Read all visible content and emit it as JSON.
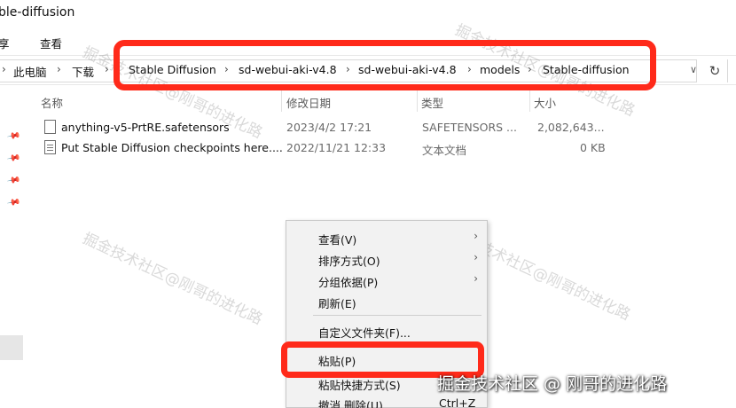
{
  "window": {
    "title": "ble-diffusion"
  },
  "ribbon": {
    "tabs": [
      "享",
      "查看"
    ]
  },
  "address": {
    "crumbs": [
      "此电脑",
      "下载",
      "Stable Diffusion",
      "sd-webui-aki-v4.8",
      "sd-webui-aki-v4.8",
      "models",
      "Stable-diffusion"
    ],
    "separator": "›"
  },
  "columns": {
    "name": "名称",
    "date": "修改日期",
    "type": "类型",
    "size": "大小"
  },
  "files": [
    {
      "name": "anything-v5-PrtRE.safetensors",
      "date": "2023/4/2 17:21",
      "type": "SAFETENSORS ...",
      "size": "2,082,643...",
      "icon": "file-icon"
    },
    {
      "name": "Put Stable Diffusion checkpoints here....",
      "date": "2022/11/21 12:33",
      "type": "文本文档",
      "size": "0 KB",
      "icon": "text-file-icon"
    }
  ],
  "context_menu": {
    "items": [
      {
        "label": "查看(V)",
        "submenu": true
      },
      {
        "label": "排序方式(O)",
        "submenu": true
      },
      {
        "label": "分组依据(P)",
        "submenu": true
      },
      {
        "label": "刷新(E)",
        "submenu": false
      },
      {
        "label": "自定义文件夹(F)...",
        "submenu": false
      },
      {
        "label": "粘贴(P)",
        "submenu": false
      },
      {
        "label": "粘贴快捷方式(S)",
        "submenu": false
      },
      {
        "label": "撤消 删除(U)",
        "submenu": false,
        "shortcut": "Ctrl+Z"
      }
    ]
  },
  "watermark": {
    "text": "掘金技术社区@刚哥的进化路",
    "credit": "掘金技术社区 @ 刚哥的进化路"
  },
  "colors": {
    "highlight": "#ff2a1a"
  }
}
